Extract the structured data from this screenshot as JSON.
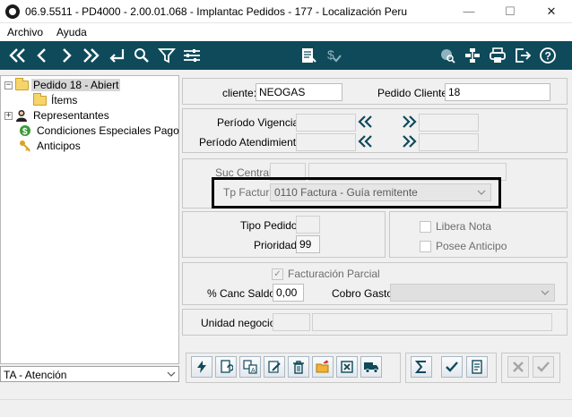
{
  "window": {
    "title": "06.9.5511 - PD4000 - 2.00.01.068 - Implantac Pedidos - 177 - Localización Peru",
    "minimize": "—",
    "maximize": "☐",
    "close": "✕"
  },
  "menu": {
    "items": [
      "Archivo",
      "Ayuda"
    ]
  },
  "toolbar": {
    "icons": [
      "first-icon",
      "prev-icon",
      "next-icon",
      "last-icon",
      "return-icon",
      "search-icon",
      "filter-icon",
      "settings-icon",
      "report-icon",
      "currency-icon",
      "globe-search-icon",
      "network-icon",
      "print-icon",
      "exit-icon",
      "help-icon"
    ],
    "bg_color": "#0e4a5a"
  },
  "tree": {
    "items": [
      {
        "label": "Pedido 18 - Abiert",
        "icon": "folder-icon",
        "expander": "−",
        "selected": true
      },
      {
        "label": "Ítems",
        "icon": "folder-icon"
      },
      {
        "label": "Representantes",
        "icon": "person-icon",
        "expander": "+"
      },
      {
        "label": "Condiciones Especiales Pago",
        "icon": "money-icon"
      },
      {
        "label": "Anticipos",
        "icon": "key-icon"
      }
    ]
  },
  "bottom_select": {
    "value": "TA - Atención"
  },
  "form": {
    "cliente_label": "cliente:",
    "cliente_value": "NEOGAS",
    "pedido_cliente_label": "Pedido Cliente:",
    "pedido_cliente_value": "18",
    "periodo_vigencia_label": "Período Vigencia:",
    "periodo_atendimiento_label": "Período Atendimiento:",
    "suc_central_label": "Suc Central:",
    "tp_factur_label": "Tp Factur:",
    "tp_factur_value": "0110 Factura - Guía remitente",
    "tipo_pedido_label": "Tipo Pedido:",
    "tipo_pedido_value": "",
    "prioridad_label": "Prioridad:",
    "prioridad_value": "99",
    "libera_nota_label": "Libera Nota",
    "posee_anticipo_label": "Posee Anticipo",
    "facturacion_parcial_label": "Facturación Parcial",
    "canc_saldo_label": "% Canc Saldo:",
    "canc_saldo_value": "0,00",
    "cobro_gasto_label": "Cobro Gasto:",
    "unidad_negocio_label": "Unidad negocio:"
  },
  "actions": {
    "icons": [
      "lightning-icon",
      "doc-refresh-icon",
      "doc-translate-icon",
      "doc-edit-icon",
      "trash-icon",
      "open-folder-icon",
      "cancel-box-icon",
      "truck-icon",
      "sigma-icon",
      "check-icon",
      "document-icon",
      "cancel-icon",
      "confirm-icon"
    ]
  }
}
